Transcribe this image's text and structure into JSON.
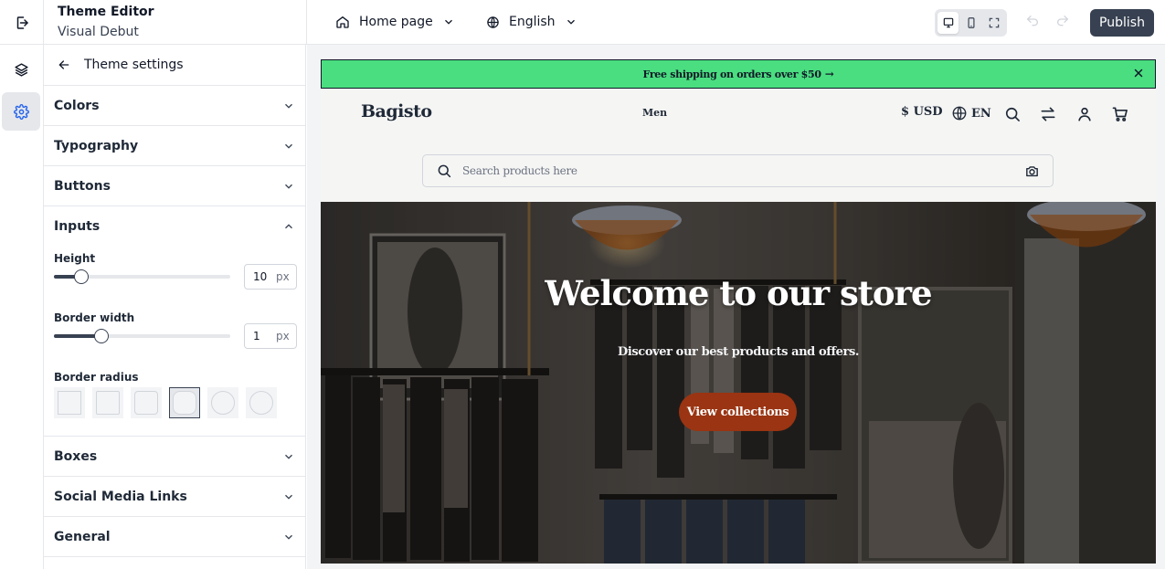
{
  "app": {
    "title": "Theme Editor",
    "theme_name": "Visual Debut"
  },
  "toolbar": {
    "page_select": "Home page",
    "language_select": "English",
    "devices": [
      "desktop",
      "mobile",
      "fullscreen"
    ],
    "active_device": "desktop",
    "publish_label": "Publish"
  },
  "rail": {
    "items": [
      {
        "icon": "layers-icon",
        "active": false
      },
      {
        "icon": "gear-icon",
        "active": true
      }
    ]
  },
  "panel": {
    "back_title": "Theme settings",
    "sections": {
      "colors": "Colors",
      "typography": "Typography",
      "buttons": "Buttons",
      "inputs": "Inputs",
      "boxes": "Boxes",
      "social": "Social Media Links",
      "general": "General"
    },
    "inputs": {
      "height": {
        "label": "Height",
        "value": "10",
        "unit": "px",
        "slider_fraction": 0.155
      },
      "border_width": {
        "label": "Border width",
        "value": "1",
        "unit": "px",
        "slider_fraction": 0.27
      },
      "border_radius": {
        "label": "Border radius",
        "options": 6,
        "selected_index": 3
      }
    }
  },
  "preview": {
    "announcement": "Free shipping on orders over $50",
    "announcement_arrow": "→",
    "logo": "Bagisto",
    "nav": [
      "Men"
    ],
    "currency": "$ USD",
    "locale": "EN",
    "search_placeholder": "Search products here",
    "hero": {
      "title": "Welcome to our store",
      "subtitle": "Discover our best products and offers.",
      "cta": "View collections"
    }
  },
  "colors": {
    "announcement_bg": "#4ade80",
    "publish_bg": "#374151",
    "cta_bg": "#9a3412"
  }
}
